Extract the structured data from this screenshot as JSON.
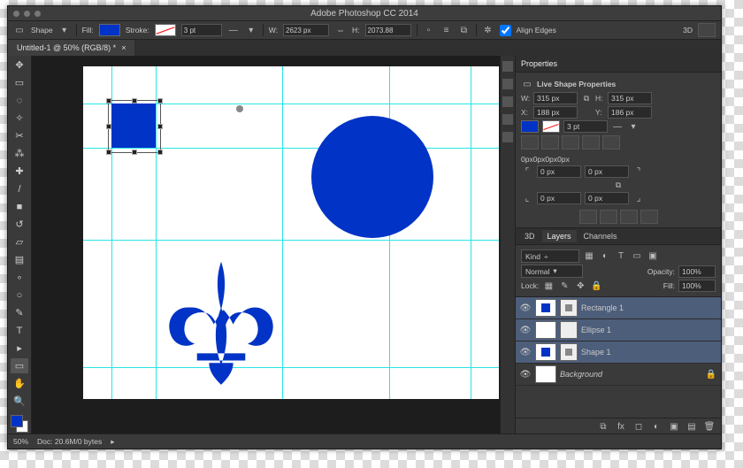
{
  "app_title": "Adobe Photoshop CC 2014",
  "doc_tab": "Untitled-1 @ 50% (RGB/8) *",
  "options": {
    "tool_label": "Shape",
    "fill_label": "Fill:",
    "stroke_label": "Stroke:",
    "stroke_pt": "3 pt",
    "w_label": "W:",
    "w_val": "2623 px",
    "h_label": "H:",
    "h_val": "2073.88",
    "align_edges": "Align Edges",
    "top_tab": "3D"
  },
  "properties": {
    "tab": "Properties",
    "title": "Live Shape Properties",
    "w_label": "W:",
    "w_val": "315 px",
    "h_label": "H:",
    "h_val": "315 px",
    "x_label": "X:",
    "x_val": "188 px",
    "y_label": "Y:",
    "y_val": "186 px",
    "stroke_pt": "3 pt",
    "corners_label": "0px0px0px0px",
    "corner_val": "0 px"
  },
  "layers_panel": {
    "tabs": [
      "3D",
      "Layers",
      "Channels"
    ],
    "kind_label": "Kind",
    "blend": "Normal",
    "opacity_label": "Opacity:",
    "opacity_val": "100%",
    "lock_label": "Lock:",
    "fill_label": "Fill:",
    "fill_val": "100%",
    "layers": [
      {
        "name": "Rectangle 1",
        "shape": "rect",
        "selected": true
      },
      {
        "name": "Ellipse 1",
        "shape": "circle",
        "selected": true
      },
      {
        "name": "Shape 1",
        "shape": "rect",
        "selected": true
      },
      {
        "name": "Background",
        "shape": "bg",
        "selected": false
      }
    ]
  },
  "status": {
    "zoom": "50%",
    "doc_info": "Doc: 20.6M/0 bytes"
  }
}
